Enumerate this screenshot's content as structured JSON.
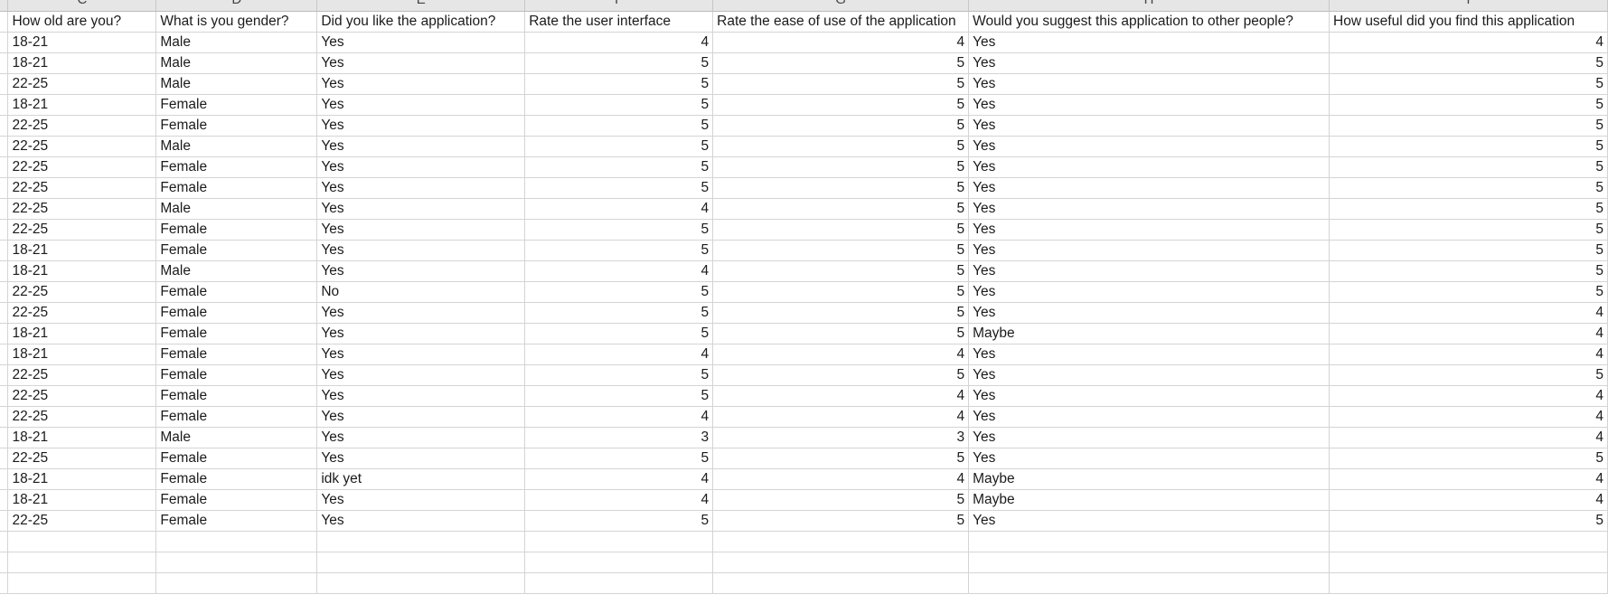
{
  "spreadsheet": {
    "column_letters": [
      "C",
      "D",
      "E",
      "F",
      "G",
      "H",
      "I"
    ],
    "headers": [
      "How old are you?",
      "What is you gender?",
      "Did you like the application?",
      "Rate the user interface",
      "Rate the ease of use of the application",
      "Would you suggest this application to other people?",
      "How useful did you find this application"
    ],
    "rows": [
      [
        "18-21",
        "Male",
        "Yes",
        "4",
        "4",
        "Yes",
        "4"
      ],
      [
        "18-21",
        "Male",
        "Yes",
        "5",
        "5",
        "Yes",
        "5"
      ],
      [
        "22-25",
        "Male",
        "Yes",
        "5",
        "5",
        "Yes",
        "5"
      ],
      [
        "18-21",
        "Female",
        "Yes",
        "5",
        "5",
        "Yes",
        "5"
      ],
      [
        "22-25",
        "Female",
        "Yes",
        "5",
        "5",
        "Yes",
        "5"
      ],
      [
        "22-25",
        "Male",
        "Yes",
        "5",
        "5",
        "Yes",
        "5"
      ],
      [
        "22-25",
        "Female",
        "Yes",
        "5",
        "5",
        "Yes",
        "5"
      ],
      [
        "22-25",
        "Female",
        "Yes",
        "5",
        "5",
        "Yes",
        "5"
      ],
      [
        "22-25",
        "Male",
        "Yes",
        "4",
        "5",
        "Yes",
        "5"
      ],
      [
        "22-25",
        "Female",
        "Yes",
        "5",
        "5",
        "Yes",
        "5"
      ],
      [
        "18-21",
        "Female",
        "Yes",
        "5",
        "5",
        "Yes",
        "5"
      ],
      [
        "18-21",
        "Male",
        "Yes",
        "4",
        "5",
        "Yes",
        "5"
      ],
      [
        "22-25",
        "Female",
        "No",
        "5",
        "5",
        "Yes",
        "5"
      ],
      [
        "22-25",
        "Female",
        "Yes",
        "5",
        "5",
        "Yes",
        "4"
      ],
      [
        "18-21",
        "Female",
        "Yes",
        "5",
        "5",
        "Maybe",
        "4"
      ],
      [
        "18-21",
        "Female",
        "Yes",
        "4",
        "4",
        "Yes",
        "4"
      ],
      [
        "22-25",
        "Female",
        "Yes",
        "5",
        "5",
        "Yes",
        "5"
      ],
      [
        "22-25",
        "Female",
        "Yes",
        "5",
        "4",
        "Yes",
        "4"
      ],
      [
        "22-25",
        "Female",
        "Yes",
        "4",
        "4",
        "Yes",
        "4"
      ],
      [
        "18-21",
        "Male",
        "Yes",
        "3",
        "3",
        "Yes",
        "4"
      ],
      [
        "22-25",
        "Female",
        "Yes",
        "5",
        "5",
        "Yes",
        "5"
      ],
      [
        "18-21",
        "Female",
        "idk yet",
        "4",
        "4",
        "Maybe",
        "4"
      ],
      [
        "18-21",
        "Female",
        "Yes",
        "4",
        "5",
        "Maybe",
        "4"
      ],
      [
        "22-25",
        "Female",
        "Yes",
        "5",
        "5",
        "Yes",
        "5"
      ]
    ],
    "empty_rows_after": 3
  }
}
